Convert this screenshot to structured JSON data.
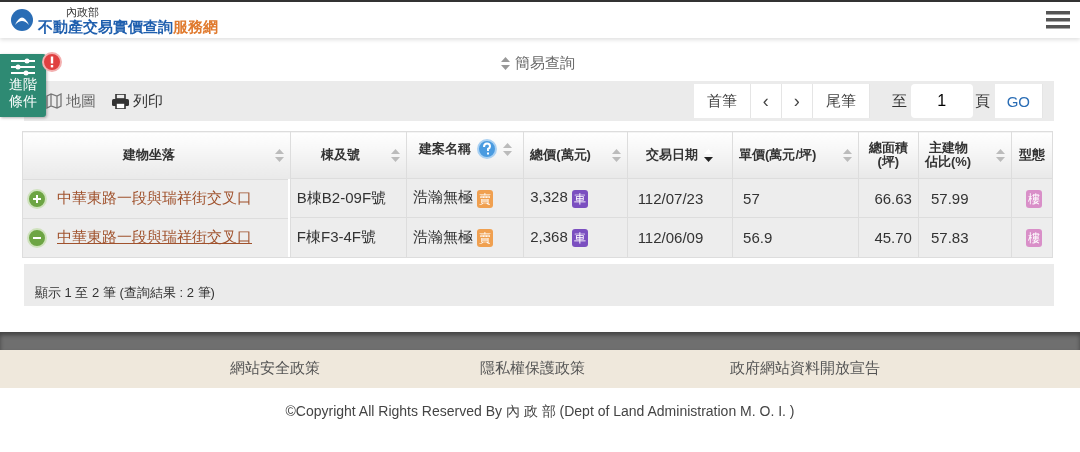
{
  "header": {
    "ministry": "內政部",
    "title_main": "不動產交易實價查詢",
    "title_accent": "服務網"
  },
  "filter_button": {
    "label": [
      "進階",
      "條件"
    ],
    "alert": true
  },
  "simple_query": "簡易查詢",
  "toolbar": {
    "links": [
      {
        "kind": "map",
        "label": "地圖"
      },
      {
        "kind": "print",
        "label": "列印"
      }
    ],
    "pager": {
      "first": "首筆",
      "prev": "‹",
      "next": "›",
      "last": "尾筆",
      "to": "至",
      "page": "1",
      "page_unit": "頁",
      "go": "GO"
    }
  },
  "table": {
    "columns": [
      {
        "label": [
          "建物坐落"
        ],
        "sortable": true,
        "sorted_descending": false
      },
      {
        "label": [
          "棟及號"
        ],
        "sortable": true,
        "sorted_descending": false
      },
      {
        "label": [
          "建案名稱"
        ],
        "sortable": true,
        "sorted_descending": false,
        "help": true
      },
      {
        "label": [
          "總價(萬元)"
        ],
        "sortable": true,
        "sorted_descending": false
      },
      {
        "label": [
          "交易日期"
        ],
        "sortable": true,
        "sorted_descending": true
      },
      {
        "label": [
          "單價(萬元/坪)"
        ],
        "sortable": true,
        "sorted_descending": false
      },
      {
        "label": [
          "總面積",
          "(坪)"
        ],
        "sortable": false
      },
      {
        "label": [
          "主建物",
          "佔比(%)"
        ],
        "sortable": true,
        "sorted_descending": false
      },
      {
        "label": [
          "型態"
        ],
        "sortable": false
      }
    ],
    "rows": [
      {
        "expanded": false,
        "address": "中華東路一段與瑞祥街交叉口",
        "unit": "B棟B2-09F號",
        "project": "浩瀚無極",
        "project_tag": {
          "text": "賣",
          "color": "#f0a050"
        },
        "price": "3,328",
        "price_tag": {
          "text": "車",
          "color": "#7b4fc0"
        },
        "date": "112/07/23",
        "unit_price": "57",
        "area": "66.63",
        "main_ratio": "57.99",
        "type_tag": {
          "text": "樓",
          "color": "#d98fc8"
        }
      },
      {
        "expanded": true,
        "address": "中華東路一段與瑞祥街交叉口",
        "unit": "F棟F3-4F號",
        "project": "浩瀚無極",
        "project_tag": {
          "text": "賣",
          "color": "#f0a050"
        },
        "price": "2,368",
        "price_tag": {
          "text": "車",
          "color": "#7b4fc0"
        },
        "date": "112/06/09",
        "unit_price": "56.9",
        "area": "45.70",
        "main_ratio": "57.83",
        "type_tag": {
          "text": "樓",
          "color": "#d98fc8"
        }
      }
    ]
  },
  "summary": "顯示 1 至 2 筆 (查詢結果 : 2 筆)",
  "footer": {
    "links": [
      "網站安全政策",
      "隱私權保護政策",
      "政府網站資料開放宣告"
    ],
    "copyright": "©Copyright All Rights Reserved By 內 政 部 (Dept of Land Administration M. O. I. )"
  }
}
